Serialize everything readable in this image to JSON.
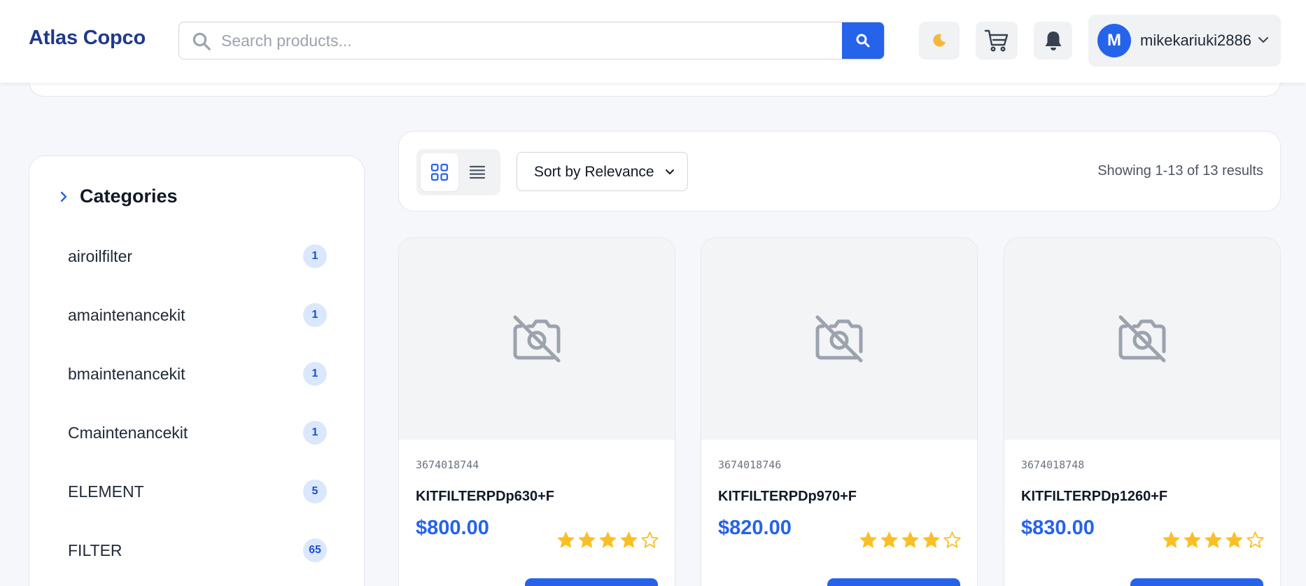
{
  "header": {
    "brand": "Atlas Copco",
    "search_placeholder": "Search products...",
    "user": {
      "initial": "M",
      "name": "mikekariuki2886"
    },
    "icons": [
      "search-icon",
      "moon-icon",
      "cart-icon",
      "bell-icon",
      "chevron-down-icon"
    ]
  },
  "sidebar": {
    "title": "Categories",
    "items": [
      {
        "label": "airoilfilter",
        "count": "1"
      },
      {
        "label": "amaintenancekit",
        "count": "1"
      },
      {
        "label": "bmaintenancekit",
        "count": "1"
      },
      {
        "label": "Cmaintenancekit",
        "count": "1"
      },
      {
        "label": "ELEMENT",
        "count": "5"
      },
      {
        "label": "FILTER",
        "count": "65"
      }
    ]
  },
  "toolbar": {
    "view_mode": "grid",
    "sort_label": "Sort by Relevance",
    "results_text": "Showing 1-13 of 13 results"
  },
  "products": [
    {
      "sku": "3674018744",
      "name": "KITFILTERPDp630+F",
      "price": "$800.00",
      "rating": 4,
      "max_rating": 5
    },
    {
      "sku": "3674018746",
      "name": "KITFILTERPDp970+F",
      "price": "$820.00",
      "rating": 4,
      "max_rating": 5
    },
    {
      "sku": "3674018748",
      "name": "KITFILTERPDp1260+F",
      "price": "$830.00",
      "rating": 4,
      "max_rating": 5
    }
  ],
  "colors": {
    "accent": "#2563eb",
    "brand": "#1e3a8a",
    "star": "#fbbf24"
  }
}
